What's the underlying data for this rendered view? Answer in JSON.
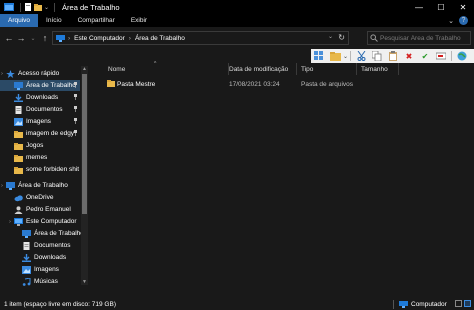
{
  "window": {
    "title": "Área de Trabalho",
    "controls": {
      "minimize": "—",
      "maximize": "☐",
      "close": "✕"
    }
  },
  "ribbon": {
    "tabs": [
      "Arquivo",
      "Início",
      "Compartilhar",
      "Exibir"
    ],
    "active_tab": "Arquivo",
    "expand_glyph": "⌄",
    "help_glyph": "?"
  },
  "nav": {
    "back": "←",
    "forward": "→",
    "recent": "⌄",
    "up": "↑",
    "breadcrumb": [
      "Este Computador",
      "Área de Trabalho"
    ],
    "crumb_separator": "›",
    "address_dropdown": "⌄",
    "refresh": "↻",
    "search_placeholder": "Pesquisar Área de Trabalho"
  },
  "sidebar": {
    "items": [
      {
        "label": "Acesso rápido",
        "icon": "star-icon",
        "level": 0,
        "pinned": false
      },
      {
        "label": "Área de Trabalho",
        "icon": "desktop-icon",
        "level": 1,
        "pinned": true,
        "selected": true
      },
      {
        "label": "Downloads",
        "icon": "download-icon",
        "level": 1,
        "pinned": true
      },
      {
        "label": "Documentos",
        "icon": "document-icon",
        "level": 1,
        "pinned": true
      },
      {
        "label": "Imagens",
        "icon": "image-icon",
        "level": 1,
        "pinned": true
      },
      {
        "label": "imagem de edgy",
        "icon": "folder-icon",
        "level": 1,
        "pinned": true
      },
      {
        "label": "Jogos",
        "icon": "folder-icon",
        "level": 1,
        "pinned": false
      },
      {
        "label": "memes",
        "icon": "folder-icon",
        "level": 1,
        "pinned": false
      },
      {
        "label": "some forbiden shit",
        "icon": "folder-icon",
        "level": 1,
        "pinned": false
      },
      {
        "label": "Área de Trabalho",
        "icon": "desktop-icon",
        "level": 0,
        "pinned": false
      },
      {
        "label": "OneDrive",
        "icon": "cloud-icon",
        "level": 1,
        "pinned": false
      },
      {
        "label": "Pedro Emanuel",
        "icon": "user-icon",
        "level": 1,
        "pinned": false
      },
      {
        "label": "Este Computador",
        "icon": "computer-icon",
        "level": 1,
        "pinned": false
      },
      {
        "label": "Área de Trabalho",
        "icon": "desktop-icon",
        "level": 2,
        "pinned": false
      },
      {
        "label": "Documentos",
        "icon": "document-icon",
        "level": 2,
        "pinned": false
      },
      {
        "label": "Downloads",
        "icon": "download-icon",
        "level": 2,
        "pinned": false
      },
      {
        "label": "Imagens",
        "icon": "image-icon",
        "level": 2,
        "pinned": false
      },
      {
        "label": "Músicas",
        "icon": "music-icon",
        "level": 2,
        "pinned": false
      }
    ],
    "pin_glyph": "📌"
  },
  "list": {
    "columns": [
      "Nome",
      "Data de modificação",
      "Tipo",
      "Tamanho"
    ],
    "rows": [
      {
        "name": "Pasta Mestre",
        "modified": "17/08/2021 03:24",
        "type": "Pasta de arquivos",
        "size": ""
      }
    ]
  },
  "status": {
    "left": "1 item  (espaço livre em disco: 719 GB)",
    "right": "Computador"
  },
  "colors": {
    "accent": "#2a6ab0",
    "selection": "#2b4a66",
    "folder": "#e8b84a",
    "background": "#191919"
  }
}
